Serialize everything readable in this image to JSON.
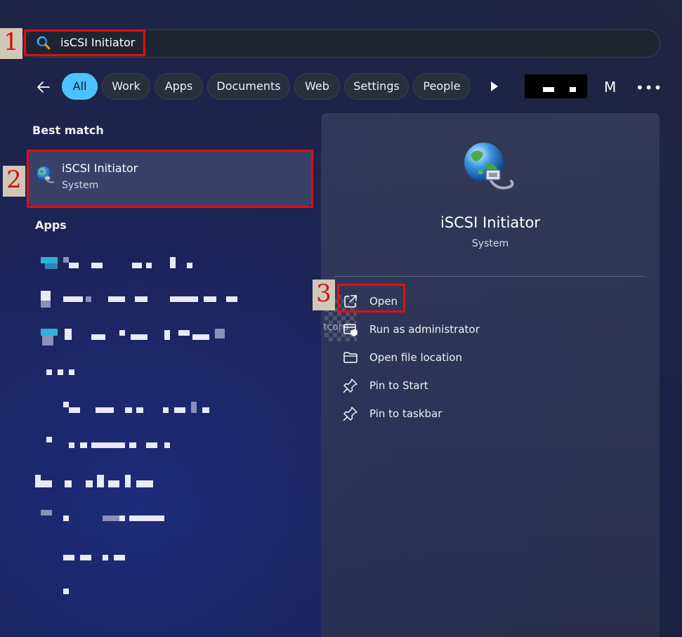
{
  "search": {
    "query": "isCSI Initiator"
  },
  "filters": {
    "items": [
      {
        "label": "All",
        "active": true
      },
      {
        "label": "Work"
      },
      {
        "label": "Apps"
      },
      {
        "label": "Documents"
      },
      {
        "label": "Web"
      },
      {
        "label": "Settings"
      },
      {
        "label": "People"
      }
    ],
    "avatar_initial": "M",
    "more_label": "•••"
  },
  "results": {
    "best_match_label": "Best match",
    "best_match": {
      "title": "iSCSI Initiator",
      "subtitle": "System"
    },
    "apps_label": "Apps"
  },
  "detail": {
    "title": "iSCSI Initiator",
    "subtitle": "System",
    "actions": [
      {
        "label": "Open",
        "icon": "open-external-icon"
      },
      {
        "label": "Run as administrator",
        "icon": "admin-shield-icon"
      },
      {
        "label": "Open file location",
        "icon": "folder-icon"
      },
      {
        "label": "Pin to Start",
        "icon": "pin-icon"
      },
      {
        "label": "Pin to taskbar",
        "icon": "pin-icon"
      }
    ],
    "watermark": "tcorp"
  },
  "markers": {
    "one": "1",
    "two": "2",
    "three": "3"
  },
  "colors": {
    "accent": "#4cc2ff",
    "marker": "#e01010"
  }
}
